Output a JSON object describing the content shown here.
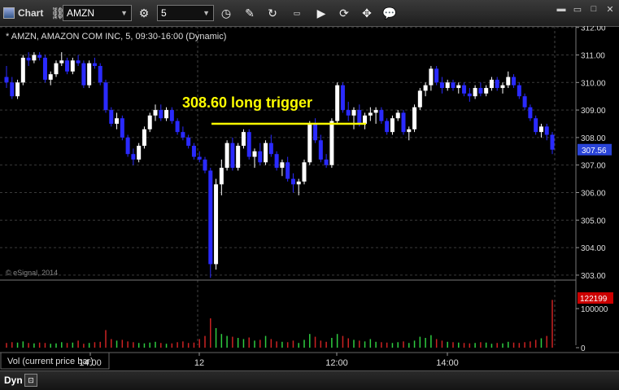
{
  "toolbar": {
    "app_label": "Chart",
    "symbol": "AMZN",
    "interval": "5"
  },
  "statusbar": {
    "mode": "Dyn"
  },
  "colors": {
    "up": "#ffffff",
    "down": "#2a2aff",
    "annotation": "#ffff00",
    "vol_up": "#2ecc40",
    "vol_down": "#cc2222",
    "last_price_tag": "#2a44d8",
    "vol_tag": "#cc0000"
  },
  "chart_data": {
    "type": "candlestick",
    "title": "* AMZN, AMAZON COM INC, 5, 09:30-16:00 (Dynamic)",
    "watermark": "© eSignal, 2014",
    "annotation": {
      "text": "308.60 long trigger",
      "level": 308.5
    },
    "last_price": "307.56",
    "price_axis": {
      "ticks": [
        303,
        304,
        305,
        306,
        307,
        308,
        309,
        310,
        311,
        312
      ],
      "labels": [
        "303.00",
        "304.00",
        "305.00",
        "306.00",
        "307.00",
        "308.00",
        "309.00",
        "310.00",
        "311.00",
        "312.00"
      ],
      "min": 302.85,
      "max": 312.05
    },
    "time_axis": {
      "labels": [
        "14:00",
        "12",
        "12:00",
        "14:00"
      ]
    },
    "volume_panel": {
      "label": "Vol (current price bar)",
      "ticks": [
        "100000",
        "0"
      ],
      "last_volume": "122199"
    },
    "candles": [
      [
        310.2,
        310.6,
        309.8,
        310.0
      ],
      [
        310.0,
        310.2,
        309.4,
        309.5
      ],
      [
        309.5,
        310.1,
        309.4,
        310.0
      ],
      [
        310.0,
        311.0,
        309.9,
        310.9
      ],
      [
        310.9,
        311.1,
        310.6,
        310.8
      ],
      [
        310.8,
        311.1,
        310.7,
        311.0
      ],
      [
        311.0,
        311.1,
        310.8,
        310.9
      ],
      [
        310.9,
        311.0,
        310.0,
        310.1
      ],
      [
        310.1,
        310.4,
        309.9,
        310.3
      ],
      [
        310.3,
        310.8,
        310.2,
        310.7
      ],
      [
        310.7,
        311.1,
        310.6,
        310.8
      ],
      [
        310.8,
        310.9,
        310.3,
        310.4
      ],
      [
        310.4,
        310.9,
        310.3,
        310.8
      ],
      [
        310.8,
        311.0,
        310.6,
        310.7
      ],
      [
        310.7,
        310.8,
        309.8,
        309.9
      ],
      [
        309.9,
        310.8,
        309.8,
        310.7
      ],
      [
        310.7,
        310.9,
        310.5,
        310.6
      ],
      [
        310.6,
        310.7,
        309.9,
        310.0
      ],
      [
        310.0,
        310.1,
        308.9,
        309.0
      ],
      [
        309.0,
        309.1,
        308.4,
        308.5
      ],
      [
        308.5,
        308.9,
        308.3,
        308.7
      ],
      [
        308.7,
        308.8,
        307.9,
        308.0
      ],
      [
        308.0,
        308.1,
        307.3,
        307.4
      ],
      [
        307.4,
        307.6,
        307.0,
        307.2
      ],
      [
        307.2,
        307.8,
        307.1,
        307.7
      ],
      [
        307.7,
        308.4,
        307.6,
        308.3
      ],
      [
        308.3,
        308.9,
        308.2,
        308.8
      ],
      [
        308.8,
        309.2,
        308.6,
        309.0
      ],
      [
        309.0,
        309.2,
        308.6,
        308.7
      ],
      [
        308.7,
        309.1,
        308.6,
        309.0
      ],
      [
        309.0,
        309.1,
        308.5,
        308.6
      ],
      [
        308.6,
        308.7,
        308.1,
        308.2
      ],
      [
        308.2,
        308.4,
        307.9,
        308.0
      ],
      [
        308.0,
        308.1,
        307.6,
        307.7
      ],
      [
        307.7,
        307.8,
        307.2,
        307.3
      ],
      [
        307.3,
        307.5,
        307.1,
        307.2
      ],
      [
        307.2,
        307.3,
        306.7,
        306.8
      ],
      [
        306.8,
        306.9,
        302.9,
        303.4
      ],
      [
        303.4,
        306.5,
        303.2,
        306.3
      ],
      [
        306.3,
        307.2,
        305.9,
        306.9
      ],
      [
        306.9,
        307.9,
        306.8,
        307.8
      ],
      [
        307.8,
        308.0,
        306.8,
        306.9
      ],
      [
        306.9,
        307.8,
        306.8,
        307.7
      ],
      [
        307.7,
        308.3,
        307.6,
        308.2
      ],
      [
        308.2,
        308.3,
        307.2,
        307.3
      ],
      [
        307.3,
        307.6,
        306.9,
        307.5
      ],
      [
        307.5,
        307.8,
        307.0,
        307.1
      ],
      [
        307.1,
        307.9,
        307.0,
        307.8
      ],
      [
        307.8,
        308.1,
        307.3,
        307.4
      ],
      [
        307.4,
        307.5,
        306.8,
        306.9
      ],
      [
        306.9,
        307.2,
        306.6,
        307.1
      ],
      [
        307.1,
        307.3,
        306.4,
        306.5
      ],
      [
        306.5,
        306.7,
        306.0,
        306.3
      ],
      [
        306.3,
        306.5,
        305.9,
        306.4
      ],
      [
        306.4,
        307.2,
        306.3,
        307.1
      ],
      [
        307.1,
        308.6,
        307.0,
        308.5
      ],
      [
        308.5,
        308.7,
        307.8,
        307.9
      ],
      [
        307.9,
        308.1,
        307.1,
        307.2
      ],
      [
        307.2,
        307.4,
        306.9,
        307.0
      ],
      [
        307.0,
        308.7,
        306.9,
        308.6
      ],
      [
        308.6,
        310.0,
        308.5,
        309.9
      ],
      [
        309.9,
        310.0,
        308.9,
        309.0
      ],
      [
        309.0,
        309.3,
        308.6,
        308.8
      ],
      [
        308.8,
        309.1,
        308.3,
        309.0
      ],
      [
        309.0,
        309.2,
        308.4,
        308.5
      ],
      [
        308.5,
        308.9,
        308.3,
        308.8
      ],
      [
        308.8,
        309.1,
        308.6,
        308.9
      ],
      [
        308.9,
        309.1,
        308.5,
        309.0
      ],
      [
        309.0,
        309.1,
        308.5,
        308.6
      ],
      [
        308.6,
        308.7,
        308.1,
        308.2
      ],
      [
        308.2,
        308.8,
        308.1,
        308.7
      ],
      [
        308.7,
        309.0,
        308.6,
        308.9
      ],
      [
        308.9,
        309.0,
        308.1,
        308.2
      ],
      [
        308.2,
        308.4,
        307.9,
        308.3
      ],
      [
        308.3,
        309.2,
        308.2,
        309.1
      ],
      [
        309.1,
        309.8,
        309.0,
        309.7
      ],
      [
        309.7,
        310.0,
        309.5,
        309.9
      ],
      [
        309.9,
        310.6,
        309.7,
        310.5
      ],
      [
        310.5,
        310.6,
        309.9,
        310.0
      ],
      [
        310.0,
        310.2,
        309.6,
        309.8
      ],
      [
        309.8,
        310.1,
        309.7,
        310.0
      ],
      [
        310.0,
        310.1,
        309.7,
        309.8
      ],
      [
        309.8,
        310.0,
        309.6,
        309.9
      ],
      [
        309.9,
        310.0,
        309.5,
        309.6
      ],
      [
        309.6,
        309.8,
        309.3,
        309.5
      ],
      [
        309.5,
        309.9,
        309.4,
        309.8
      ],
      [
        309.8,
        310.0,
        309.5,
        309.6
      ],
      [
        309.6,
        309.9,
        309.5,
        309.8
      ],
      [
        309.8,
        310.2,
        309.7,
        310.1
      ],
      [
        310.1,
        310.2,
        309.7,
        309.8
      ],
      [
        309.8,
        310.0,
        309.6,
        309.9
      ],
      [
        309.9,
        310.4,
        309.8,
        310.2
      ],
      [
        310.2,
        310.3,
        309.8,
        309.9
      ],
      [
        309.9,
        310.0,
        309.4,
        309.5
      ],
      [
        309.5,
        309.6,
        309.0,
        309.1
      ],
      [
        309.1,
        309.2,
        308.6,
        308.7
      ],
      [
        308.7,
        308.8,
        308.1,
        308.2
      ],
      [
        308.2,
        308.5,
        308.0,
        308.4
      ],
      [
        308.4,
        308.5,
        307.9,
        308.1
      ],
      [
        308.1,
        308.2,
        307.4,
        307.56
      ]
    ],
    "volumes": [
      12000,
      14000,
      13000,
      16000,
      12000,
      11000,
      13000,
      12000,
      10000,
      11000,
      14000,
      12000,
      13000,
      18000,
      10000,
      12000,
      14000,
      15000,
      45000,
      22000,
      18000,
      20000,
      16000,
      14000,
      12000,
      11000,
      13000,
      15000,
      12000,
      10000,
      11000,
      14000,
      16000,
      12000,
      13000,
      22000,
      30000,
      75000,
      50000,
      35000,
      30000,
      28000,
      25000,
      22000,
      26000,
      18000,
      20000,
      30000,
      22000,
      16000,
      15000,
      14000,
      18000,
      12000,
      20000,
      35000,
      28000,
      18000,
      15000,
      25000,
      35000,
      30000,
      24000,
      20000,
      18000,
      16000,
      22000,
      15000,
      14000,
      13000,
      12000,
      14000,
      16000,
      12000,
      18000,
      28000,
      25000,
      32000,
      22000,
      18000,
      15000,
      14000,
      13000,
      12000,
      11000,
      12000,
      14000,
      13000,
      10000,
      12000,
      11000,
      15000,
      13000,
      12000,
      14000,
      16000,
      20000,
      24000,
      30000,
      122199
    ]
  }
}
